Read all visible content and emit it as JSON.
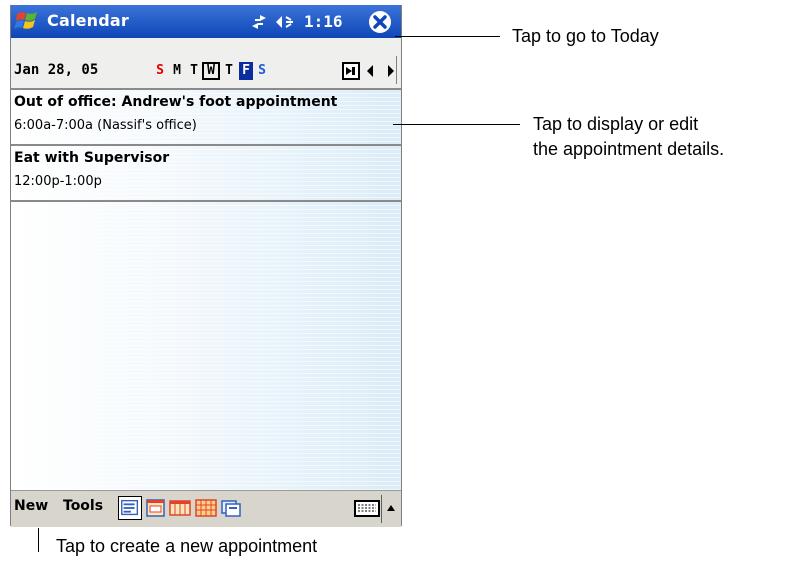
{
  "window": {
    "title": "Calendar",
    "clock": "1:16"
  },
  "toolbar": {
    "date": "Jan 28, 05",
    "days": [
      {
        "label": "S",
        "kind": "weekend"
      },
      {
        "label": "M",
        "kind": "normal"
      },
      {
        "label": "T",
        "kind": "normal"
      },
      {
        "label": "W",
        "kind": "today"
      },
      {
        "label": "T",
        "kind": "normal"
      },
      {
        "label": "F",
        "kind": "selected"
      },
      {
        "label": "S",
        "kind": "sat"
      }
    ]
  },
  "appointments": [
    {
      "title": "Out of office: Andrew's foot appointment",
      "time": "6:00a-7:00a  (Nassif's office)"
    },
    {
      "title": "Eat with Supervisor",
      "time": "12:00p-1:00p"
    }
  ],
  "menubar": {
    "new_label": "New",
    "tools_label": "Tools",
    "views": [
      "agenda-view-icon",
      "day-view-icon",
      "week-view-icon",
      "month-view-icon",
      "year-view-icon"
    ]
  },
  "callouts": {
    "today": "Tap to go to Today",
    "details_line1": "Tap to display or edit",
    "details_line2": "the appointment details.",
    "new": "Tap to create a new appointment"
  },
  "colors": {
    "titlebar": "#1a53c4",
    "weekend": "#e00000",
    "selected_day_bg": "#0a2ea0"
  }
}
